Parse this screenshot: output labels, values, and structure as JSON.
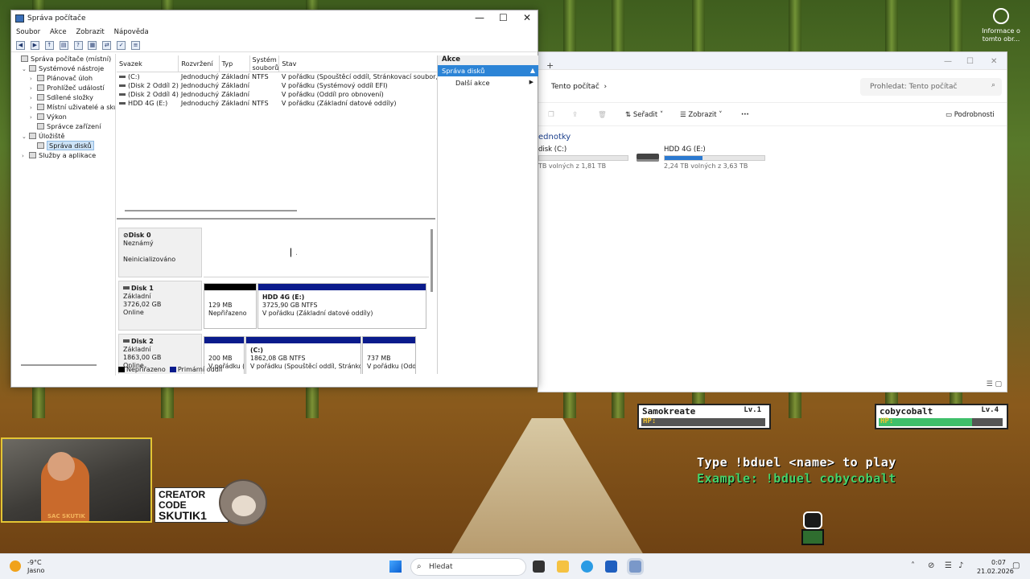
{
  "desktop_icon": {
    "label": "Informace o tomto obr..."
  },
  "explorer": {
    "breadcrumb": "Tento počítač",
    "search_placeholder": "Prohledat: Tento počítač",
    "toolbar": {
      "sort": "Seřadit",
      "view": "Zobrazit",
      "more": "···",
      "details": "Podrobnosti"
    },
    "group_title": "ednotky",
    "drives": [
      {
        "name": "disk (C:)",
        "free": "TB volných z 1,81 TB",
        "used_fraction": 0
      },
      {
        "name": "HDD 4G (E:)",
        "free": "2,24 TB volných z 3,63 TB",
        "used_fraction": 0.38
      }
    ]
  },
  "cm": {
    "title": "Správa počítače",
    "menu": [
      "Soubor",
      "Akce",
      "Zobrazit",
      "Nápověda"
    ],
    "tree": [
      {
        "label": "Správa počítače (místní)",
        "level": 0,
        "exp": ""
      },
      {
        "label": "Systémové nástroje",
        "level": 1,
        "exp": "v"
      },
      {
        "label": "Plánovač úloh",
        "level": 2,
        "exp": ">"
      },
      {
        "label": "Prohlížeč událostí",
        "level": 2,
        "exp": ">"
      },
      {
        "label": "Sdílené složky",
        "level": 2,
        "exp": ">"
      },
      {
        "label": "Místní uživatelé a skupiny",
        "level": 2,
        "exp": ">"
      },
      {
        "label": "Výkon",
        "level": 2,
        "exp": ">"
      },
      {
        "label": "Správce zařízení",
        "level": 2,
        "exp": ""
      },
      {
        "label": "Úložiště",
        "level": 1,
        "exp": "v"
      },
      {
        "label": "Správa disků",
        "level": 2,
        "exp": "",
        "selected": true
      },
      {
        "label": "Služby a aplikace",
        "level": 1,
        "exp": ">"
      }
    ],
    "volume_headers": [
      "Svazek",
      "Rozvržení",
      "Typ",
      "Systém souborů",
      "Stav"
    ],
    "volumes": [
      [
        "(C:)",
        "Jednoduchý",
        "Základní",
        "NTFS",
        "V pořádku (Spouštěcí oddíl, Stránkovací soubor,"
      ],
      [
        "(Disk 2 Oddíl 2)",
        "Jednoduchý",
        "Základní",
        "",
        "V pořádku (Systémový oddíl EFI)"
      ],
      [
        "(Disk 2 Oddíl 4)",
        "Jednoduchý",
        "Základní",
        "",
        "V pořádku (Oddíl pro obnovení)"
      ],
      [
        "HDD 4G (E:)",
        "Jednoduchý",
        "Základní",
        "NTFS",
        "V pořádku (Základní datové oddíly)"
      ]
    ],
    "disks": [
      {
        "name": "Disk 0",
        "type": "Neznámý",
        "size": "",
        "status": "Neinicializováno"
      },
      {
        "name": "Disk 1",
        "type": "Základní",
        "size": "3726,02 GB",
        "status": "Online",
        "parts": [
          {
            "title": "",
            "l1": "129 MB",
            "l2": "Nepřiřazeno",
            "strip": "black"
          },
          {
            "title": "HDD 4G  (E:)",
            "l1": "3725,90 GB NTFS",
            "l2": "V pořádku (Základní datové oddíly)",
            "strip": "navy"
          }
        ]
      },
      {
        "name": "Disk 2",
        "type": "Základní",
        "size": "1863,00 GB",
        "status": "Online",
        "parts": [
          {
            "title": "",
            "l1": "200 MB",
            "l2": "V pořádku (S",
            "strip": "navy"
          },
          {
            "title": "(C:)",
            "l1": "1862,08 GB NTFS",
            "l2": "V pořádku (Spouštěcí oddíl, Stránkova",
            "strip": "navy"
          },
          {
            "title": "",
            "l1": "737 MB",
            "l2": "V pořádku (Oddí",
            "strip": "navy"
          }
        ]
      }
    ],
    "legend": [
      {
        "label": "Nepřiřazeno",
        "color": "#000000"
      },
      {
        "label": "Primární oddíl",
        "color": "#0a1b8c"
      }
    ],
    "actions": {
      "header": "Akce",
      "section": "Správa disků",
      "more": "Další akce"
    }
  },
  "game": {
    "players": [
      {
        "name": "Samokreate",
        "level": "Lv.1",
        "hp_label": "HP:",
        "hp_fraction": 0
      },
      {
        "name": "cobycobalt",
        "level": "Lv.4",
        "hp_label": "HP:",
        "hp_fraction": 0.75
      }
    ],
    "line1": "Type !bduel <name> to play",
    "line2": "Example: !bduel cobycobalt"
  },
  "stream": {
    "cam_tag": "SAC SKUTIK",
    "creator_lines": [
      "CREATOR",
      "CODE",
      "SKUTIK1"
    ]
  },
  "taskbar": {
    "temp": "-9°C",
    "weather": "Jasno",
    "search": "Hledat",
    "time": "0:07",
    "date": "21.02.2026"
  }
}
